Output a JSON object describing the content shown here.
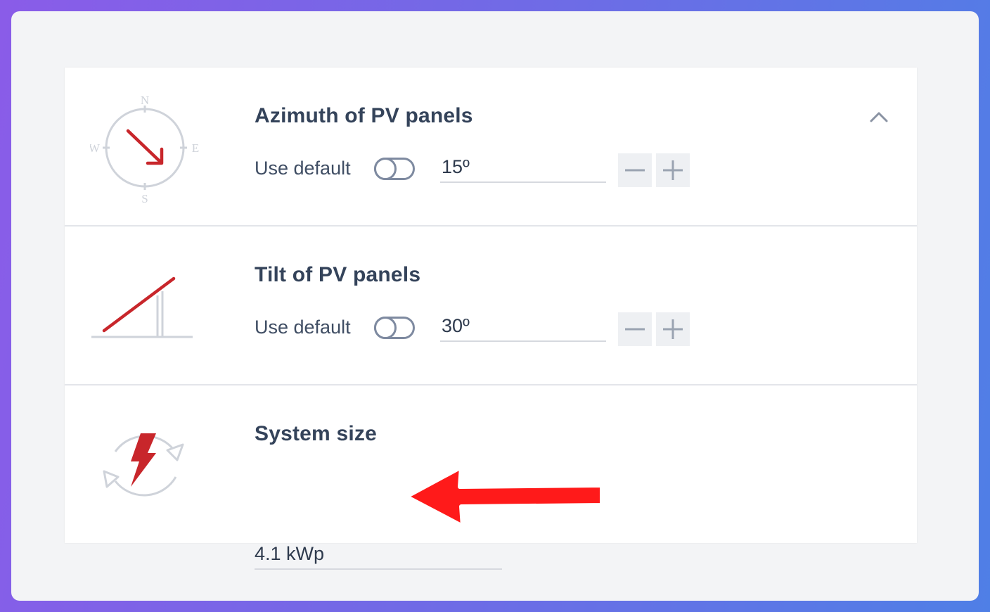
{
  "sections": {
    "azimuth": {
      "title": "Azimuth of PV panels",
      "use_default_label": "Use default",
      "use_default_on": false,
      "value": "15º",
      "compass": {
        "n": "N",
        "s": "S",
        "e": "E",
        "w": "W"
      }
    },
    "tilt": {
      "title": "Tilt of PV panels",
      "use_default_label": "Use default",
      "use_default_on": false,
      "value": "30º"
    },
    "system_size": {
      "title": "System size",
      "value": "4.1 kWp"
    }
  },
  "icons": {
    "collapse": "chevron-up-icon",
    "decrement": "minus-icon",
    "increment": "plus-icon",
    "azimuth": "compass-icon",
    "tilt": "tilt-panel-icon",
    "system_size": "lightning-cycle-icon",
    "annotation": "red-arrow-icon"
  },
  "colors": {
    "accent_red": "#c8262b",
    "annotation_red": "#ff1a1a",
    "title_text": "#34435a",
    "icon_gray": "#cfd3da"
  }
}
